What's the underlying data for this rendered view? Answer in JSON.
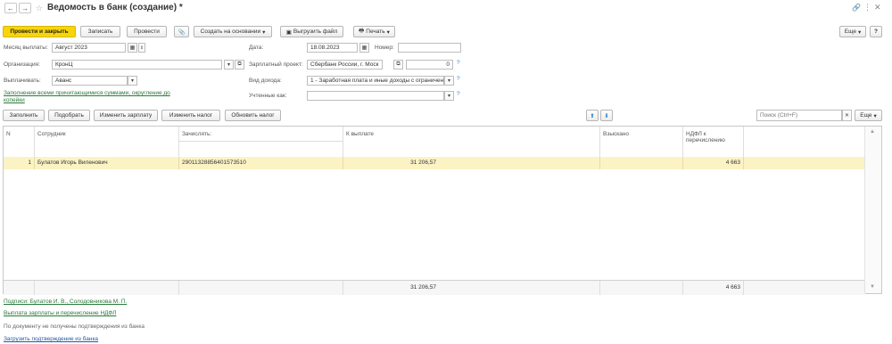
{
  "header": {
    "title": "Ведомость в банк (создание) *",
    "back": "←",
    "forward": "→",
    "star": "☆"
  },
  "toolbar": {
    "post_close": "Провести и закрыть",
    "save": "Записать",
    "post": "Провести",
    "create_based": "Создать на основании",
    "upload_file": "Выгрузить файл",
    "print": "Печать",
    "more": "Еще",
    "help": "?"
  },
  "form": {
    "month_label": "Месяц выплаты:",
    "month_value": "Август 2023",
    "date_label": "Дата:",
    "date_value": "18.08.2023",
    "number_label": "Номер:",
    "number_value": "",
    "org_label": "Организация:",
    "org_value": "КронЦ",
    "project_label": "Зарплатный проект:",
    "project_value": "Сбербанк России, г. Моск",
    "project_num": "0",
    "pay_label": "Выплачивать:",
    "pay_value": "Аванс",
    "income_label": "Вид дохода:",
    "income_value": "1 - Заработная плата и иные доходы с ограничен",
    "accounted_label": "Учтенные как:",
    "accounted_value": "",
    "fill_link": "Заполнение всеми причитающимися суммами, округление до копейки"
  },
  "table_toolbar": {
    "fill": "Заполнить",
    "pick": "Подобрать",
    "change_salary": "Изменить зарплату",
    "change_tax": "Изменить налог",
    "update_tax": "Обновить налог",
    "search_placeholder": "Поиск (Ctrl+F)",
    "more": "Еще"
  },
  "table": {
    "headers": [
      "N",
      "Сотрудник",
      "Зачислять:",
      "К выплате",
      "Взыскано",
      "НДФЛ к перечислению"
    ],
    "rows": [
      {
        "n": "1",
        "employee": "Булатов Игорь Виленович",
        "account": "29011328856401573510",
        "payout": "31 206,57",
        "withheld": "",
        "ndfl": "4 663"
      }
    ],
    "totals": {
      "payout": "31 206,57",
      "ndfl": "4 663"
    }
  },
  "footer": {
    "signatures": "Подписи: Булатов И. В., Солодовникова М. П.",
    "salary_ndfl": "Выплата зарплаты и перечисление НДФЛ",
    "no_confirm": "По документу не получены подтверждения из банка",
    "load_confirm": "Загрузить подтверждение из банка"
  }
}
